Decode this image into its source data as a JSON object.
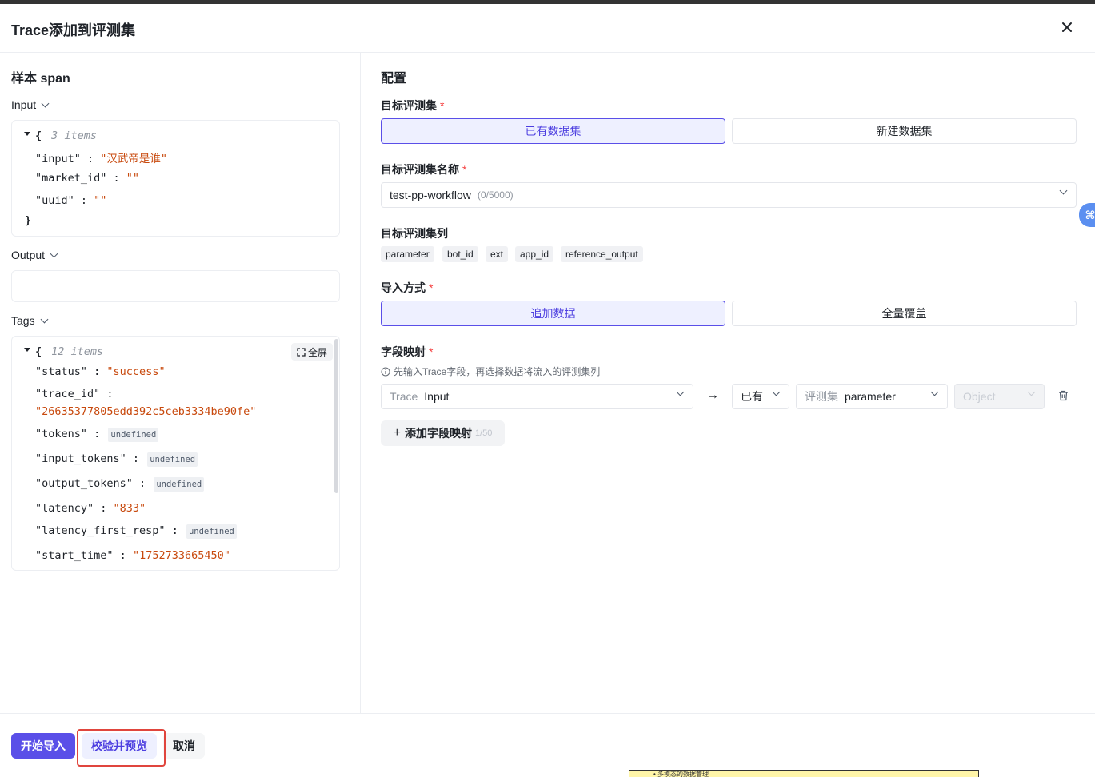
{
  "dialog": {
    "title": "Trace添加到评测集",
    "close_glyph": "✕"
  },
  "sample": {
    "heading": "样本 span",
    "input_label": "Input",
    "input_json": {
      "count_text": "3 items",
      "lines": [
        {
          "key": "\"input\"",
          "value": "\"汉武帝是谁\""
        },
        {
          "key": "\"market_id\"",
          "value": "\"\""
        },
        {
          "key": "\"uuid\"",
          "value": "\"\""
        }
      ]
    },
    "output_label": "Output",
    "tags_label": "Tags",
    "tags_json": {
      "count_text": "12 items",
      "fullscreen_label": "全屏",
      "status_key": "\"status\"",
      "status_value": "\"success\"",
      "trace_id_key": "\"trace_id\"",
      "trace_id_value": "\"26635377805edd392c5ceb3334be90fe\"",
      "tokens_key": "\"tokens\"",
      "input_tokens_key": "\"input_tokens\"",
      "output_tokens_key": "\"output_tokens\"",
      "latency_key": "\"latency\"",
      "latency_value": "\"833\"",
      "latency_first_resp_key": "\"latency_first_resp\"",
      "start_time_key": "\"start_time\"",
      "start_time_value": "\"1752733665450\"",
      "undefined_text": "undefined"
    }
  },
  "config": {
    "heading": "配置",
    "target_dataset_label": "目标评测集",
    "target_dataset_options": [
      "已有数据集",
      "新建数据集"
    ],
    "dataset_name_label": "目标评测集名称",
    "dataset_name_value": "test-pp-workflow",
    "dataset_name_count": "(0/5000)",
    "columns_label": "目标评测集列",
    "columns": [
      "parameter",
      "bot_id",
      "ext",
      "app_id",
      "reference_output"
    ],
    "import_mode_label": "导入方式",
    "import_mode_options": [
      "追加数据",
      "全量覆盖"
    ],
    "field_mapping_label": "字段映射",
    "field_mapping_hint": "先输入Trace字段，再选择数据将流入的评测集列",
    "mapping": {
      "trace_prefix": "Trace",
      "trace_field": "Input",
      "arrow": "→",
      "existing": "已有",
      "dataset_prefix": "评测集",
      "dataset_field": "parameter",
      "type": "Object"
    },
    "add_mapping_label": "添加字段映射",
    "add_mapping_count": "1/50"
  },
  "footer": {
    "start_import": "开始导入",
    "validate_preview": "校验并预览",
    "cancel": "取消"
  },
  "note_text": "• 多模态的数据管理",
  "colors": {
    "primary": "#5a4fe8",
    "string_value": "#c8490d",
    "required": "#f53f3f",
    "highlight_box": "#e0453d"
  }
}
